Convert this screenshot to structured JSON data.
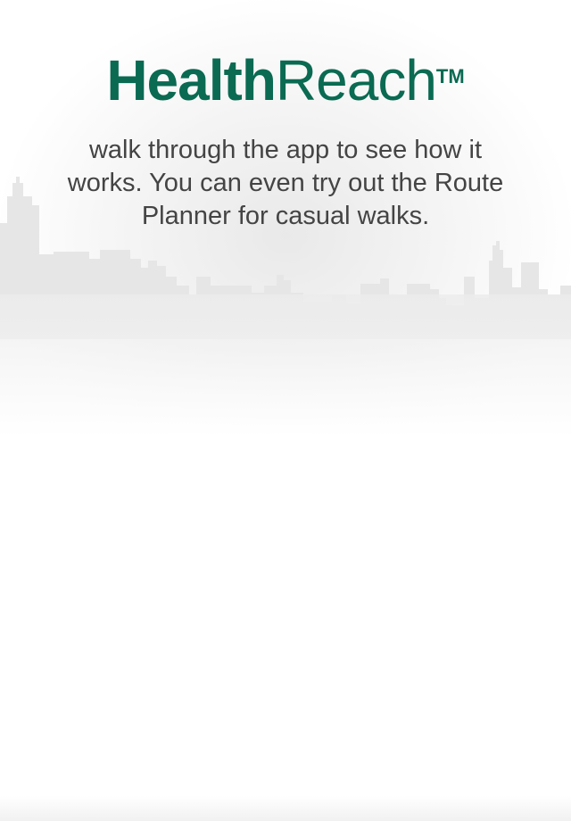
{
  "brand": {
    "name_bold": "Health",
    "name_light": "Reach",
    "trademark": "TM",
    "color": "#0a6a52"
  },
  "intro": {
    "message": "walk through the app to see how it works. You can even try out the Route Planner for casual walks."
  },
  "decor": {
    "background": "city-skyline"
  }
}
